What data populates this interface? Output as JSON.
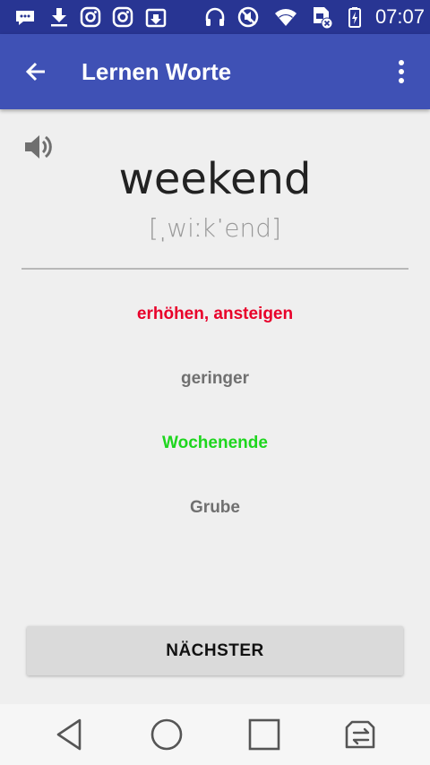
{
  "status_bar": {
    "time": "07:07",
    "icons": [
      "messages-icon",
      "download-icon",
      "instagram-icon",
      "instagram-icon",
      "package-icon",
      "headphones-icon",
      "mute-icon",
      "wifi-icon",
      "sim-error-icon",
      "battery-charging-icon"
    ]
  },
  "app_bar": {
    "title": "Lernen Worte",
    "back_icon": "arrow-back-icon",
    "menu_icon": "more-vert-icon"
  },
  "card": {
    "word": "weekend",
    "phonetic": "[ˌwiːkˈend]",
    "speaker_icon": "volume-icon"
  },
  "options": [
    {
      "label": "erhöhen, ansteigen",
      "color": "#e8002a"
    },
    {
      "label": "geringer",
      "color": "#707070"
    },
    {
      "label": "Wochenende",
      "color": "#1ed61e"
    },
    {
      "label": "Grube",
      "color": "#707070"
    }
  ],
  "next_button": {
    "label": "NÄCHSTER"
  },
  "nav_bar": {
    "icons": [
      "back-triangle-icon",
      "home-circle-icon",
      "recents-square-icon",
      "switch-app-icon"
    ]
  },
  "colors": {
    "status_bar": "#283593",
    "app_bar": "#3f51b5",
    "background": "#efefef"
  }
}
